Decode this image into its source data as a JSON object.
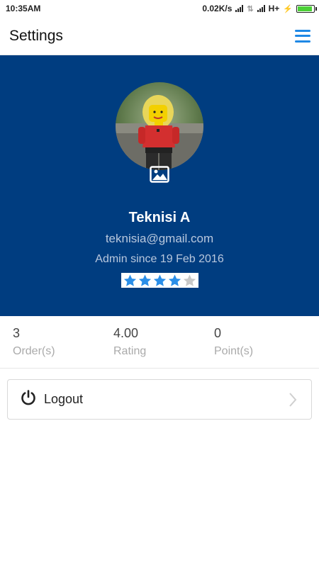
{
  "status_bar": {
    "time": "10:35AM",
    "network_speed": "0.02K/s",
    "network_type": "H+"
  },
  "app_bar": {
    "title": "Settings",
    "menu_icon": "hamburger-menu-icon"
  },
  "profile": {
    "name": "Teknisi A",
    "email": "teknisia@gmail.com",
    "member_since": "Admin since 19 Feb 2016",
    "rating_stars": 4,
    "rating_max": 5,
    "avatar_icon": "image-icon"
  },
  "stats": [
    {
      "value": "3",
      "label": "Order(s)"
    },
    {
      "value": "4.00",
      "label": "Rating"
    },
    {
      "value": "0",
      "label": "Point(s)"
    }
  ],
  "logout": {
    "label": "Logout",
    "icon": "power-icon",
    "chevron": "chevron-right-icon"
  },
  "colors": {
    "hero_bg": "#003d80",
    "accent": "#1e88e5",
    "star_filled": "#2a8ee8",
    "star_empty": "#c8c8c8"
  }
}
